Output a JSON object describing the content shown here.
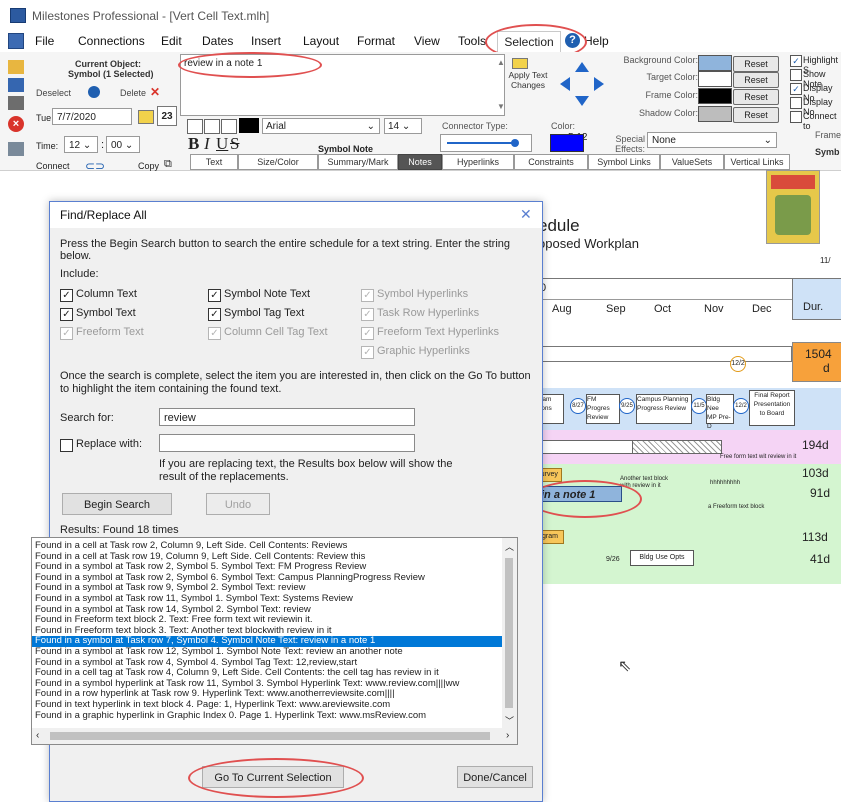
{
  "window": {
    "title": "Milestones Professional - [Vert Cell Text.mlh]"
  },
  "menu": {
    "items": [
      "File",
      "Connections",
      "Edit",
      "Dates",
      "Insert",
      "Layout",
      "Format",
      "View",
      "Tools",
      "Selection",
      "Help"
    ]
  },
  "ribbon": {
    "current_object_label": "Current Object:",
    "current_object_value": "Symbol (1 Selected)",
    "deselect": "Deselect",
    "delete": "Delete",
    "day": "Tue",
    "date": "7/7/2020",
    "calendar_day": "23",
    "time_label": "Time:",
    "hour": "12",
    "minute": "00",
    "connect": "Connect",
    "copy": "Copy",
    "note_text": "review in a note 1",
    "apply_text": "Apply Text Changes",
    "coords": "5,12",
    "font_name": "Arial",
    "font_size": "14",
    "symbol_note": "Symbol Note",
    "bold": "B",
    "italic": "I",
    "underline": "U",
    "strike": "S",
    "connector_type": "Connector Type:",
    "color_label": "Color:",
    "special_effects_label": "Special Effects:",
    "special_effects_value": "None",
    "bg_color": "Background Color:",
    "target_color": "Target Color:",
    "frame_color": "Frame Color:",
    "shadow_color": "Shadow Color:",
    "reset": "Reset",
    "right_opts": [
      "Highlight S",
      "Show Note",
      "Display No",
      "Display No",
      "Connect to"
    ],
    "frame_label": "Frame",
    "symb_label": "Symb",
    "tabs": [
      "Text",
      "Size/Color",
      "Summary/Mark",
      "Notes",
      "Hyperlinks",
      "Constraints",
      "Symbol Links",
      "ValueSets",
      "Vertical Links"
    ]
  },
  "schedule": {
    "heading1": "edule",
    "heading2": "oposed Workplan",
    "corner_date": "11/",
    "col_zero": "0",
    "months": [
      "Aug",
      "Sep",
      "Oct",
      "Nov",
      "Dec"
    ],
    "dur_header": "Dur.",
    "durations": [
      "1504",
      "d",
      "194d",
      "103d",
      "91d",
      "113d",
      "41d"
    ],
    "row_labels": [
      "ogram",
      "ditions",
      "FM Progres",
      "Review",
      "Campus Planning",
      "Progress Review",
      "Bldg Nee",
      "MP Pre-D",
      "Final Report",
      "Presentation",
      "to Board"
    ],
    "dates": [
      "8/27",
      "9/25",
      "11/5",
      "12/2",
      "12/2"
    ],
    "survey": "Survey",
    "note_highlight": "in a note 1",
    "text_block1": "Another text block",
    "text_block1b": "with review in it",
    "freeform1": "Free form text wit review in it",
    "hhh": "hhhhhhhhh",
    "freeform2": "a Freeform text block",
    "ogram2": "ogram",
    "date_926": "9/26",
    "bldg_use": "Bldg Use Opts"
  },
  "dialog": {
    "title": "Find/Replace All",
    "instructions": "Press the Begin Search button to search the entire schedule for a text string. Enter the string below.",
    "include_label": "Include:",
    "options": {
      "column_text": "Column Text",
      "symbol_text": "Symbol Text",
      "freeform_text": "Freeform Text",
      "symbol_note_text": "Symbol Note Text",
      "symbol_tag_text": "Symbol Tag Text",
      "column_cell_tag_text": "Column Cell Tag Text",
      "symbol_hyperlinks": "Symbol Hyperlinks",
      "task_row_hyperlinks": "Task Row Hyperlinks",
      "freeform_text_hyperlinks": "Freeform Text Hyperlinks",
      "graphic_hyperlinks": "Graphic Hyperlinks"
    },
    "once_complete": "Once the search is complete, select the item you are interested in, then click on the Go To button to highlight the item containing the found text.",
    "search_for_label": "Search for:",
    "search_value": "review",
    "replace_label": "Replace with:",
    "replace_value": "",
    "replace_note": "If you are replacing text, the Results box below will show the result of the replacements.",
    "begin_search": "Begin Search",
    "undo": "Undo",
    "results_label": "Results: Found 18 times",
    "results": [
      "Found in a cell at Task row 2, Column 9, Left Side. Cell Contents: Reviews",
      "Found in a cell at Task row 19, Column 9, Left Side. Cell Contents: Review this",
      "Found in a symbol at Task row 2, Symbol 5. Symbol Text: FM Progress Review",
      "Found in a symbol at Task row 2, Symbol 6. Symbol Text: Campus PlanningProgress Review",
      "Found in a symbol at Task row 9, Symbol 2. Symbol Text: review",
      "Found in a symbol at Task row 11, Symbol 1. Symbol Text: Systems Review",
      "Found in a symbol at Task row 14, Symbol 2. Symbol Text: review",
      "Found in Freeform text block 2. Text: Free form text wit reviewin it.",
      "Found in Freeform text block 3. Text: Another text blockwith review in it",
      "Found in a symbol at Task row 7, Symbol 4. Symbol Note Text: review in a note 1",
      "Found in a symbol at Task row 12, Symbol 1. Symbol Note Text: review an another note",
      "Found in a symbol at Task row 4, Symbol 4. Symbol Tag Text: 12,review,start",
      "Found in a cell tag at Task row 4, Column 9, Left Side. Cell Contents: the cell tag has review in it",
      "Found in a symbol hyperlink at Task row 11, Symbol 3. Symbol Hyperlink Text: www.review.com||||ww",
      "Found in a row hyperlink at Task row 9. Hyperlink Text: www.anotherreviewsite.com||||",
      "Found in text hyperlink in text block 4. Page: 1, Hyperlink Text: www.areviewsite.com",
      "Found in a graphic hyperlink in Graphic Index 0. Page 1. Hyperlink Text: www.msReview.com"
    ],
    "selected_index": 9,
    "goto_button": "Go To Current Selection",
    "done_button": "Done/Cancel"
  },
  "colors": {
    "selection_blue": "#0078d7",
    "highlight_ellipse": "#e05050",
    "dur_orange": "#f7a13b",
    "row_pink": "#f5d4f5",
    "row_green": "#d4f5d0",
    "row_blue": "#cfe2f7"
  }
}
